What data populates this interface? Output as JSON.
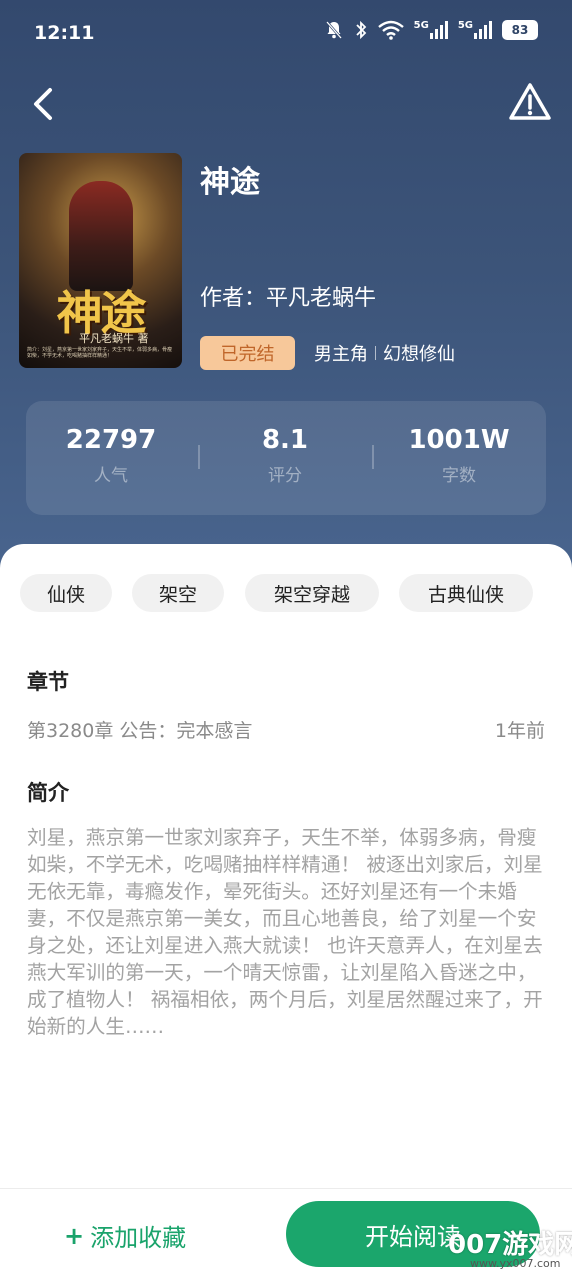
{
  "status_bar": {
    "time": "12:11",
    "signal1_label": "5G",
    "signal2_label": "5G",
    "battery": "83"
  },
  "book": {
    "title": "神途",
    "author": "作者：平凡老蜗牛",
    "status": "已完结",
    "genre_primary": "男主角",
    "genre_secondary": "幻想修仙",
    "cover": {
      "title_text": "神途",
      "author_text": "平凡老蜗牛 著",
      "blurb_text": "简介：刘星，燕京第一世家刘家弃子，天生不举，体弱多病，骨瘦如柴，不学无术，吃喝赌抽样样精通！"
    }
  },
  "stats": [
    {
      "value": "22797",
      "label": "人气"
    },
    {
      "value": "8.1",
      "label": "评分"
    },
    {
      "value": "1001W",
      "label": "字数"
    }
  ],
  "tags": [
    "仙侠",
    "架空",
    "架空穿越",
    "古典仙侠"
  ],
  "chapters": {
    "heading": "章节",
    "latest": "第3280章 公告：完本感言",
    "latest_time": "1年前"
  },
  "synopsis": {
    "heading": "简介",
    "text": "刘星，燕京第一世家刘家弃子，天生不举，体弱多病，骨瘦如柴，不学无术，吃喝赌抽样样精通！ 被逐出刘家后，刘星无依无靠，毒瘾发作，晕死街头。还好刘星还有一个未婚妻，不仅是燕京第一美女，而且心地善良，给了刘星一个安身之处，还让刘星进入燕大就读！ 也许天意弄人，在刘星去燕大军训的第一天，一个晴天惊雷，让刘星陷入昏迷之中，成了植物人！ 祸福相依，两个月后，刘星居然醒过来了，开始新的人生……"
  },
  "actions": {
    "favorite_label": "添加收藏",
    "favorite_plus": "+",
    "read_label": "开始阅读"
  },
  "watermark": {
    "main": "007游戏网",
    "sub": "www.yx007.com"
  },
  "colors": {
    "hero_top": "#33496e",
    "hero_bottom": "#4a6690",
    "accent_green": "#1ba66c",
    "status_tag_bg": "#f7c89a",
    "status_tag_text": "#c0662a"
  }
}
